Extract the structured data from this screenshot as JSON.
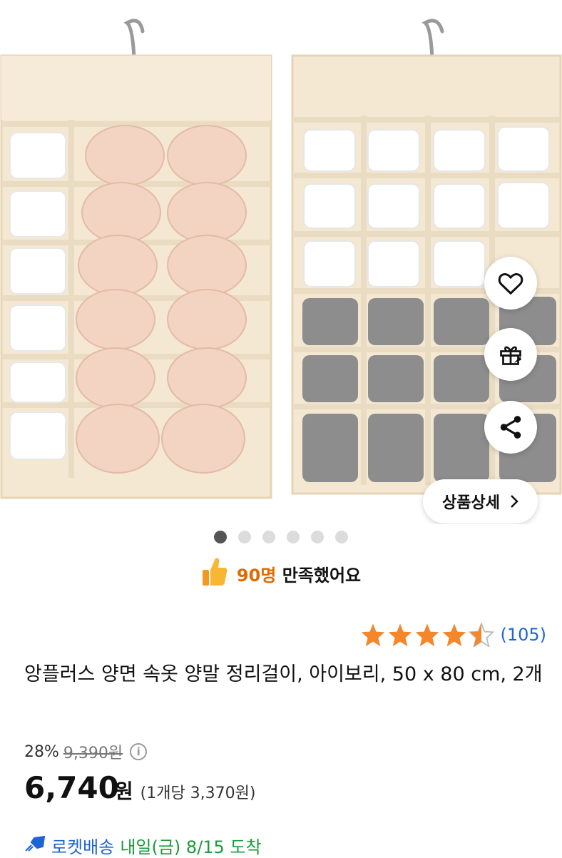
{
  "product": {
    "detail_button_label": "상품상세",
    "image_count": 6,
    "active_image_index": 0
  },
  "satisfaction": {
    "count": "90명",
    "text": "만족했어요"
  },
  "rating": {
    "stars": 4.5,
    "review_count": "(105)"
  },
  "title": "앙플러스 양면 속옷 양말 정리걸이, 아이보리, 50 x 80 cm, 2개",
  "pricing": {
    "discount": "28%",
    "original_price": "9,390원",
    "info_icon_label": "i",
    "price": "6,740",
    "price_unit": "원",
    "unit_price": "(1개당 3,370원)"
  },
  "delivery": {
    "label": "로켓배송",
    "arrival": "내일(금) 8/15 도착"
  },
  "colors": {
    "accent_orange": "#e06b00",
    "link_blue": "#1e64d6",
    "star_orange": "#f4862c",
    "arrival_green": "#1a9a3a"
  }
}
